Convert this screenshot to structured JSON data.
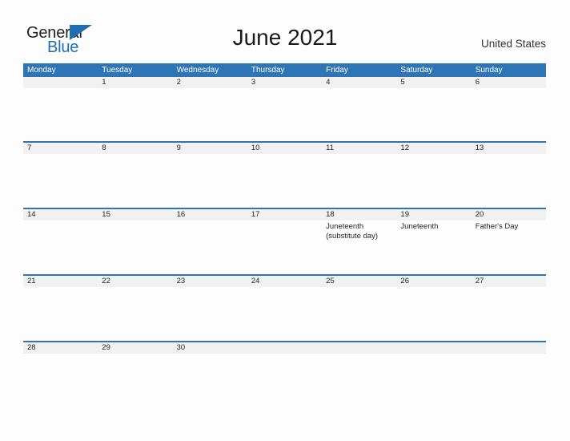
{
  "brand": {
    "name_part1": "General",
    "name_part2": "Blue",
    "triangle_icon": "blue-triangle-logo-mark",
    "colors": {
      "blue": "#1f6fb2",
      "dark": "#231f20"
    }
  },
  "header": {
    "title": "June 2021",
    "country": "United States"
  },
  "calendar": {
    "accent_color": "#2e75b6",
    "band_color": "#f1f1f1",
    "weekdays": [
      "Monday",
      "Tuesday",
      "Wednesday",
      "Thursday",
      "Friday",
      "Saturday",
      "Sunday"
    ],
    "weeks": [
      {
        "days": [
          {
            "number": "",
            "events": []
          },
          {
            "number": "1",
            "events": []
          },
          {
            "number": "2",
            "events": []
          },
          {
            "number": "3",
            "events": []
          },
          {
            "number": "4",
            "events": []
          },
          {
            "number": "5",
            "events": []
          },
          {
            "number": "6",
            "events": []
          }
        ]
      },
      {
        "days": [
          {
            "number": "7",
            "events": []
          },
          {
            "number": "8",
            "events": []
          },
          {
            "number": "9",
            "events": []
          },
          {
            "number": "10",
            "events": []
          },
          {
            "number": "11",
            "events": []
          },
          {
            "number": "12",
            "events": []
          },
          {
            "number": "13",
            "events": []
          }
        ]
      },
      {
        "days": [
          {
            "number": "14",
            "events": []
          },
          {
            "number": "15",
            "events": []
          },
          {
            "number": "16",
            "events": []
          },
          {
            "number": "17",
            "events": []
          },
          {
            "number": "18",
            "events": [
              "Juneteenth (substitute day)"
            ]
          },
          {
            "number": "19",
            "events": [
              "Juneteenth"
            ]
          },
          {
            "number": "20",
            "events": [
              "Father's Day"
            ]
          }
        ]
      },
      {
        "days": [
          {
            "number": "21",
            "events": []
          },
          {
            "number": "22",
            "events": []
          },
          {
            "number": "23",
            "events": []
          },
          {
            "number": "24",
            "events": []
          },
          {
            "number": "25",
            "events": []
          },
          {
            "number": "26",
            "events": []
          },
          {
            "number": "27",
            "events": []
          }
        ]
      },
      {
        "days": [
          {
            "number": "28",
            "events": []
          },
          {
            "number": "29",
            "events": []
          },
          {
            "number": "30",
            "events": []
          },
          {
            "number": "",
            "events": []
          },
          {
            "number": "",
            "events": []
          },
          {
            "number": "",
            "events": []
          },
          {
            "number": "",
            "events": []
          }
        ]
      }
    ]
  }
}
